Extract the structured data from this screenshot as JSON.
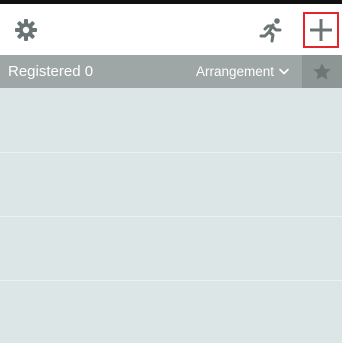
{
  "toolbar": {
    "settings_icon": "gear-icon",
    "runner_icon": "running-person-icon",
    "add_icon": "plus-icon"
  },
  "header": {
    "registered_label": "Registered 0",
    "arrangement_label": "Arrangement",
    "arrangement_icon": "chevron-down-icon",
    "star_icon": "star-icon"
  },
  "colors": {
    "header_background": "#9fa6a6",
    "list_background": "#dde6e6",
    "icon_color": "#6b7474",
    "highlight_border": "#e3262e"
  }
}
